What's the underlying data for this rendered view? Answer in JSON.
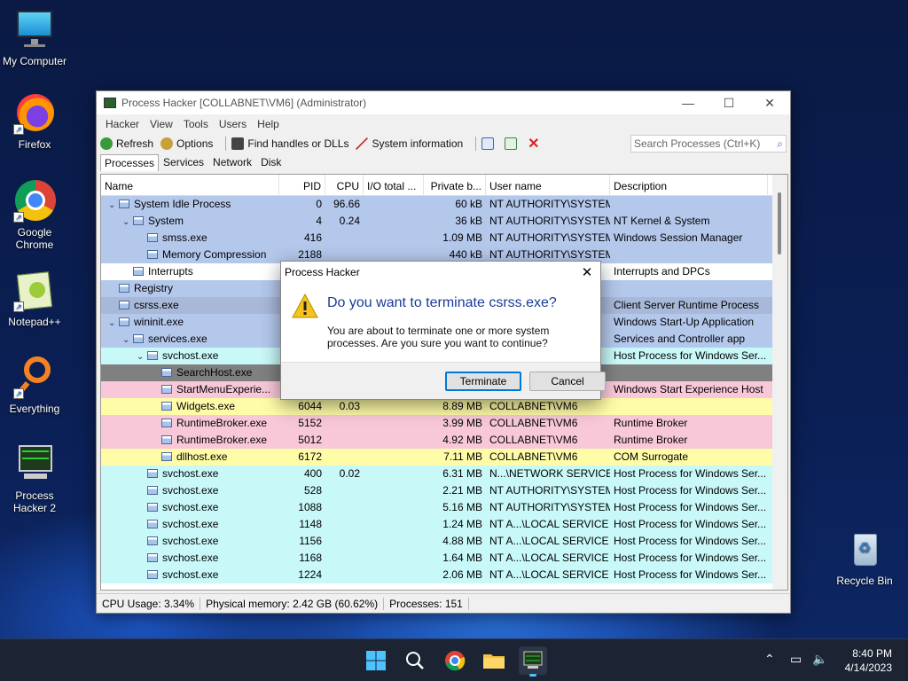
{
  "desktop": {
    "icons": [
      {
        "label": "My Computer"
      },
      {
        "label": "Firefox"
      },
      {
        "label": "Google Chrome"
      },
      {
        "label": "Notepad++"
      },
      {
        "label": "Everything"
      },
      {
        "label": "Process Hacker 2"
      },
      {
        "label": "Recycle Bin"
      }
    ]
  },
  "window": {
    "title": "Process Hacker [COLLABNET\\VM6] (Administrator)",
    "menu": [
      "Hacker",
      "View",
      "Tools",
      "Users",
      "Help"
    ],
    "toolbar": {
      "refresh": "Refresh",
      "options": "Options",
      "find": "Find handles or DLLs",
      "sysinfo": "System information",
      "search_placeholder": "Search Processes (Ctrl+K)"
    },
    "tabs": [
      "Processes",
      "Services",
      "Network",
      "Disk"
    ],
    "columns": [
      "Name",
      "PID",
      "CPU",
      "I/O total ...",
      "Private b...",
      "User name",
      "Description"
    ],
    "rows": [
      {
        "name": "System Idle Process",
        "pid": "0",
        "cpu": "96.66",
        "io": "",
        "priv": "60 kB",
        "user": "NT AUTHORITY\\SYSTEM",
        "desc": "",
        "bg": "#b4c8ec",
        "lvl": 0,
        "tw": "v"
      },
      {
        "name": "System",
        "pid": "4",
        "cpu": "0.24",
        "io": "",
        "priv": "36 kB",
        "user": "NT AUTHORITY\\SYSTEM",
        "desc": "NT Kernel & System",
        "bg": "#b4c8ec",
        "lvl": 1,
        "tw": "v"
      },
      {
        "name": "smss.exe",
        "pid": "416",
        "cpu": "",
        "io": "",
        "priv": "1.09 MB",
        "user": "NT AUTHORITY\\SYSTEM",
        "desc": "Windows Session Manager",
        "bg": "#b4c8ec",
        "lvl": 2,
        "tw": ""
      },
      {
        "name": "Memory Compression",
        "pid": "2188",
        "cpu": "",
        "io": "",
        "priv": "440 kB",
        "user": "NT AUTHORITY\\SYSTEM",
        "desc": "",
        "bg": "#b4c8ec",
        "lvl": 2,
        "tw": ""
      },
      {
        "name": "Interrupts",
        "pid": "",
        "cpu": "",
        "io": "",
        "priv": "",
        "user": "",
        "desc": "Interrupts and DPCs",
        "bg": "#ffffff",
        "lvl": 1,
        "tw": ""
      },
      {
        "name": "Registry",
        "pid": "",
        "cpu": "",
        "io": "",
        "priv": "",
        "user": "M",
        "desc": "",
        "bg": "#b4c8ec",
        "lvl": 0,
        "tw": ""
      },
      {
        "name": "csrss.exe",
        "pid": "",
        "cpu": "",
        "io": "",
        "priv": "",
        "user": "M",
        "desc": "Client Server Runtime Process",
        "bg": "#a8b8d8",
        "lvl": 0,
        "tw": ""
      },
      {
        "name": "wininit.exe",
        "pid": "",
        "cpu": "",
        "io": "",
        "priv": "",
        "user": "M",
        "desc": "Windows Start-Up Application",
        "bg": "#b4c8ec",
        "lvl": 0,
        "tw": "v"
      },
      {
        "name": "services.exe",
        "pid": "",
        "cpu": "",
        "io": "",
        "priv": "",
        "user": "M",
        "desc": "Services and Controller app",
        "bg": "#b4c8ec",
        "lvl": 1,
        "tw": "v"
      },
      {
        "name": "svchost.exe",
        "pid": "",
        "cpu": "",
        "io": "",
        "priv": "",
        "user": "",
        "desc": "Host Process for Windows Ser...",
        "bg": "#c8f8f8",
        "lvl": 2,
        "tw": "v"
      },
      {
        "name": "SearchHost.exe",
        "pid": "",
        "cpu": "",
        "io": "",
        "priv": "",
        "user": "",
        "desc": "",
        "bg": "#808080",
        "lvl": 3,
        "tw": ""
      },
      {
        "name": "StartMenuExperie...",
        "pid": "",
        "cpu": "",
        "io": "",
        "priv": "",
        "user": "",
        "desc": "Windows Start Experience Host",
        "bg": "#f8c8d8",
        "lvl": 3,
        "tw": ""
      },
      {
        "name": "Widgets.exe",
        "pid": "6044",
        "cpu": "0.03",
        "io": "",
        "priv": "8.89 MB",
        "user": "COLLABNET\\VM6",
        "desc": "",
        "bg": "#fffca8",
        "lvl": 3,
        "tw": ""
      },
      {
        "name": "RuntimeBroker.exe",
        "pid": "5152",
        "cpu": "",
        "io": "",
        "priv": "3.99 MB",
        "user": "COLLABNET\\VM6",
        "desc": "Runtime Broker",
        "bg": "#f8c8d8",
        "lvl": 3,
        "tw": ""
      },
      {
        "name": "RuntimeBroker.exe",
        "pid": "5012",
        "cpu": "",
        "io": "",
        "priv": "4.92 MB",
        "user": "COLLABNET\\VM6",
        "desc": "Runtime Broker",
        "bg": "#f8c8d8",
        "lvl": 3,
        "tw": ""
      },
      {
        "name": "dllhost.exe",
        "pid": "6172",
        "cpu": "",
        "io": "",
        "priv": "7.11 MB",
        "user": "COLLABNET\\VM6",
        "desc": "COM Surrogate",
        "bg": "#fffca8",
        "lvl": 3,
        "tw": ""
      },
      {
        "name": "svchost.exe",
        "pid": "400",
        "cpu": "0.02",
        "io": "",
        "priv": "6.31 MB",
        "user": "N...\\NETWORK SERVICE",
        "desc": "Host Process for Windows Ser...",
        "bg": "#c8f8f8",
        "lvl": 2,
        "tw": ""
      },
      {
        "name": "svchost.exe",
        "pid": "528",
        "cpu": "",
        "io": "",
        "priv": "2.21 MB",
        "user": "NT AUTHORITY\\SYSTEM",
        "desc": "Host Process for Windows Ser...",
        "bg": "#c8f8f8",
        "lvl": 2,
        "tw": ""
      },
      {
        "name": "svchost.exe",
        "pid": "1088",
        "cpu": "",
        "io": "",
        "priv": "5.16 MB",
        "user": "NT AUTHORITY\\SYSTEM",
        "desc": "Host Process for Windows Ser...",
        "bg": "#c8f8f8",
        "lvl": 2,
        "tw": ""
      },
      {
        "name": "svchost.exe",
        "pid": "1148",
        "cpu": "",
        "io": "",
        "priv": "1.24 MB",
        "user": "NT A...\\LOCAL SERVICE",
        "desc": "Host Process for Windows Ser...",
        "bg": "#c8f8f8",
        "lvl": 2,
        "tw": ""
      },
      {
        "name": "svchost.exe",
        "pid": "1156",
        "cpu": "",
        "io": "",
        "priv": "4.88 MB",
        "user": "NT A...\\LOCAL SERVICE",
        "desc": "Host Process for Windows Ser...",
        "bg": "#c8f8f8",
        "lvl": 2,
        "tw": ""
      },
      {
        "name": "svchost.exe",
        "pid": "1168",
        "cpu": "",
        "io": "",
        "priv": "1.64 MB",
        "user": "NT A...\\LOCAL SERVICE",
        "desc": "Host Process for Windows Ser...",
        "bg": "#c8f8f8",
        "lvl": 2,
        "tw": ""
      },
      {
        "name": "svchost.exe",
        "pid": "1224",
        "cpu": "",
        "io": "",
        "priv": "2.06 MB",
        "user": "NT A...\\LOCAL SERVICE",
        "desc": "Host Process for Windows Ser...",
        "bg": "#c8f8f8",
        "lvl": 2,
        "tw": ""
      }
    ],
    "status": {
      "cpu": "CPU Usage: 3.34%",
      "mem": "Physical memory: 2.42 GB (60.62%)",
      "procs": "Processes: 151"
    }
  },
  "dialog": {
    "title": "Process Hacker",
    "main": "Do you want to terminate csrss.exe?",
    "body": "You are about to terminate one or more system processes. Are you sure you want to continue?",
    "terminate": "Terminate",
    "cancel": "Cancel"
  },
  "taskbar": {
    "time": "8:40 PM",
    "date": "4/14/2023"
  }
}
